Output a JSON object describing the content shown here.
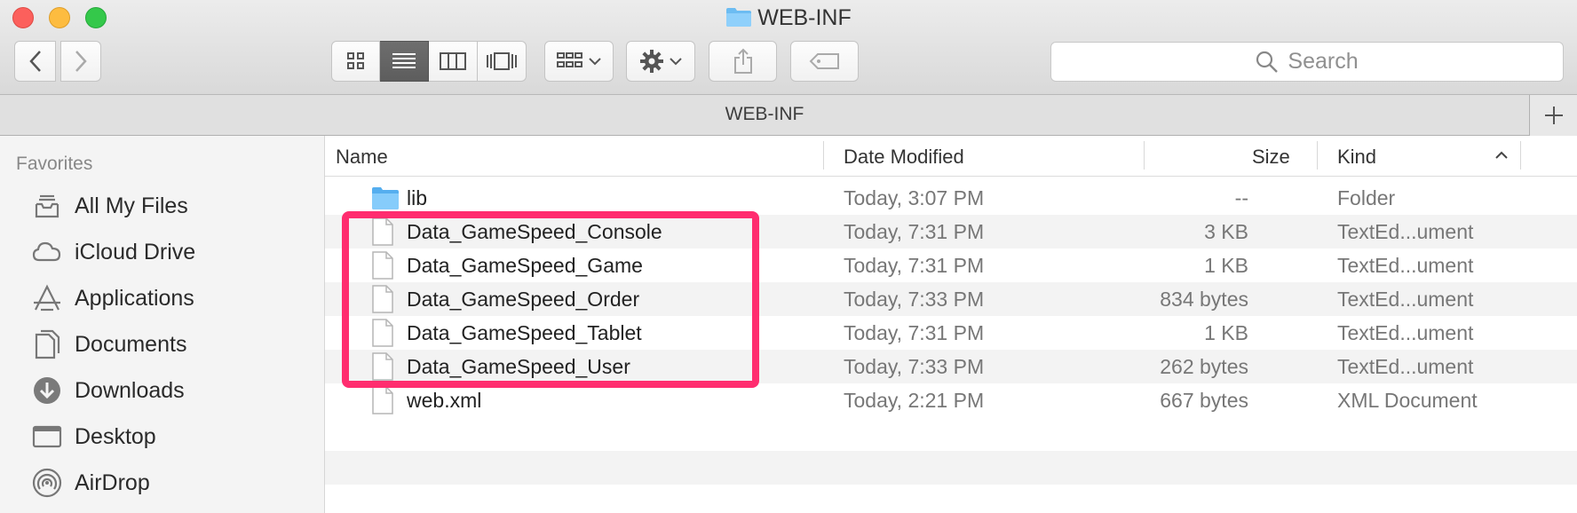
{
  "window": {
    "title": "WEB-INF"
  },
  "toolbar": {
    "back_label": "Back",
    "forward_label": "Forward",
    "search_placeholder": "Search"
  },
  "pathbar": {
    "label": "WEB-INF"
  },
  "sidebar": {
    "heading": "Favorites",
    "items": [
      {
        "label": "All My Files",
        "icon": "all-files-icon"
      },
      {
        "label": "iCloud Drive",
        "icon": "cloud-icon"
      },
      {
        "label": "Applications",
        "icon": "applications-icon"
      },
      {
        "label": "Documents",
        "icon": "documents-icon"
      },
      {
        "label": "Downloads",
        "icon": "downloads-icon"
      },
      {
        "label": "Desktop",
        "icon": "desktop-icon"
      },
      {
        "label": "AirDrop",
        "icon": "airdrop-icon"
      }
    ]
  },
  "columns": {
    "name": "Name",
    "date": "Date Modified",
    "size": "Size",
    "kind": "Kind"
  },
  "files": [
    {
      "name": "lib",
      "date": "Today, 3:07 PM",
      "size": "--",
      "kind": "Folder",
      "type": "folder"
    },
    {
      "name": "Data_GameSpeed_Console",
      "date": "Today, 7:31 PM",
      "size": "3 KB",
      "kind": "TextEd...ument",
      "type": "file"
    },
    {
      "name": "Data_GameSpeed_Game",
      "date": "Today, 7:31 PM",
      "size": "1 KB",
      "kind": "TextEd...ument",
      "type": "file"
    },
    {
      "name": "Data_GameSpeed_Order",
      "date": "Today, 7:33 PM",
      "size": "834 bytes",
      "kind": "TextEd...ument",
      "type": "file"
    },
    {
      "name": "Data_GameSpeed_Tablet",
      "date": "Today, 7:31 PM",
      "size": "1 KB",
      "kind": "TextEd...ument",
      "type": "file"
    },
    {
      "name": "Data_GameSpeed_User",
      "date": "Today, 7:33 PM",
      "size": "262 bytes",
      "kind": "TextEd...ument",
      "type": "file"
    },
    {
      "name": "web.xml",
      "date": "Today, 2:21 PM",
      "size": "667 bytes",
      "kind": "XML Document",
      "type": "file"
    }
  ],
  "colors": {
    "highlight": "#ff2d6f",
    "folder": "#5ab0ef"
  }
}
